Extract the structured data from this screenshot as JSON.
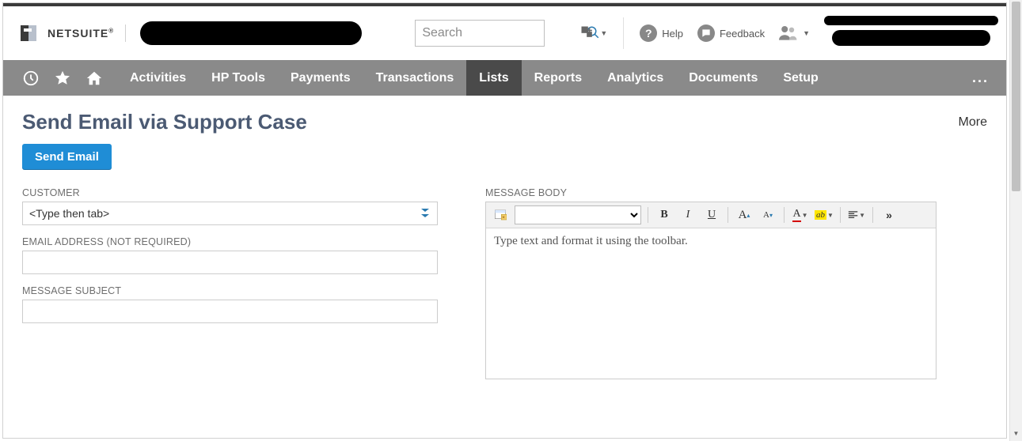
{
  "header": {
    "brand": "NETSUITE",
    "search_placeholder": "Search",
    "help_label": "Help",
    "feedback_label": "Feedback"
  },
  "nav": {
    "items": [
      "Activities",
      "HP Tools",
      "Payments",
      "Transactions",
      "Lists",
      "Reports",
      "Analytics",
      "Documents",
      "Setup"
    ],
    "active_index": 4,
    "more_glyph": "..."
  },
  "page": {
    "title": "Send Email via Support Case",
    "more_label": "More",
    "primary_button": "Send Email"
  },
  "form": {
    "customer_label": "CUSTOMER",
    "customer_placeholder": "<Type then tab>",
    "email_label": "EMAIL ADDRESS (NOT REQUIRED)",
    "subject_label": "MESSAGE SUBJECT",
    "body_label": "MESSAGE BODY",
    "editor_placeholder": "Type text and format it using the toolbar."
  },
  "toolbar_glyphs": {
    "bold": "B",
    "italic": "I",
    "underline": "U",
    "font_inc": "A",
    "font_dec": "A",
    "font_color": "A",
    "highlight": "ab",
    "more": "»"
  }
}
